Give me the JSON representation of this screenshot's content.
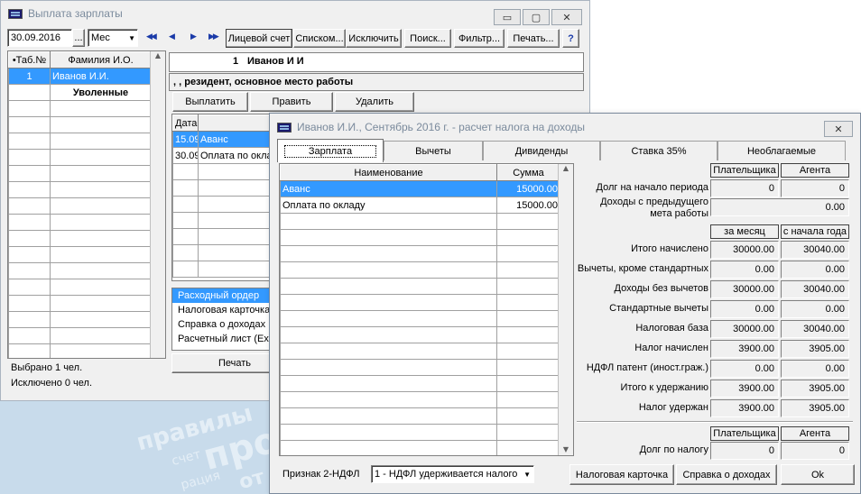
{
  "main": {
    "title": "Выплата зарплаты",
    "date": "30.09.2016",
    "period": "Мес",
    "nav": [
      "◀◀",
      "◀",
      "▶",
      "▶▶"
    ],
    "toolbar": [
      "Лицевой счет",
      "Списком...",
      "Исключить",
      "Поиск...",
      "Фильтр...",
      "Печать...",
      "?"
    ],
    "employees_header": [
      "•Таб.№",
      "Фамилия И.О."
    ],
    "employees": [
      {
        "num": "1",
        "name": "Иванов И.И."
      }
    ],
    "dismissed_label": "Уволенные",
    "selected_text": "Выбрано 1 чел.",
    "excluded_text": "Исключено 0 чел.",
    "employee_header_num": "1",
    "employee_header_name": "Иванов И И",
    "employee_status": ", , резидент, основное место работы",
    "actions": [
      "Выплатить",
      "Править",
      "Удалить"
    ],
    "payments_header": [
      "Дата",
      "Н"
    ],
    "payments": [
      {
        "date": "15.09",
        "name": "Аванс"
      },
      {
        "date": "30.09",
        "name": "Оплата по окладу"
      }
    ],
    "reports": [
      "Расходный ордер",
      "Налоговая карточка",
      "Справка о доходах",
      "Расчетный лист (Ex"
    ],
    "print_label": "Печать"
  },
  "dialog": {
    "title": "Иванов И.И., Сентябрь 2016 г. - расчет налога на доходы",
    "close": "✕",
    "tabs": [
      "Зарплата",
      "Вычеты",
      "Дивиденды",
      "Ставка 35%",
      "Необлагаемые"
    ],
    "table_header": [
      "Наименование",
      "Сумма"
    ],
    "rows": [
      {
        "name": "Аванс",
        "sum": "15000.00"
      },
      {
        "name": "Оплата по окладу",
        "sum": "15000.00"
      }
    ],
    "payer_label": "Плательщика",
    "agent_label": "Агента",
    "debt_start_label": "Долг на начало периода",
    "debt_start_payer": "0",
    "debt_start_agent": "0",
    "prev_income_label_1": "Доходы с предыдущего",
    "prev_income_label_2": "мета работы",
    "prev_income_value": "0.00",
    "month_label": "за месяц",
    "ytd_label": "с начала года",
    "metrics": [
      {
        "label": "Итого начислено",
        "month": "30000.00",
        "ytd": "30040.00"
      },
      {
        "label": "Вычеты, кроме стандартных",
        "month": "0.00",
        "ytd": "0.00"
      },
      {
        "label": "Доходы без вычетов",
        "month": "30000.00",
        "ytd": "30040.00"
      },
      {
        "label": "Стандартные вычеты",
        "month": "0.00",
        "ytd": "0.00"
      },
      {
        "label": "Налоговая база",
        "month": "30000.00",
        "ytd": "30040.00"
      },
      {
        "label": "Налог начислен",
        "month": "3900.00",
        "ytd": "3905.00"
      },
      {
        "label": "НДФЛ патент (иност.граж.)",
        "month": "0.00",
        "ytd": "0.00"
      },
      {
        "label": "Итого к удержанию",
        "month": "3900.00",
        "ytd": "3905.00"
      },
      {
        "label": "Налог удержан",
        "month": "3900.00",
        "ytd": "3905.00"
      }
    ],
    "tax_debt_label": "Долг по налогу",
    "tax_debt_payer": "0",
    "tax_debt_agent": "0",
    "sign_label": "Признак 2-НДФЛ",
    "sign_value": "1 - НДФЛ удерживается налого",
    "btn_tax_card": "Налоговая карточка",
    "btn_income_cert": "Справка о доходах",
    "btn_ok": "Ok"
  },
  "watermark": [
    "правилы",
    "счет",
    "про",
    "рация",
    "от"
  ]
}
